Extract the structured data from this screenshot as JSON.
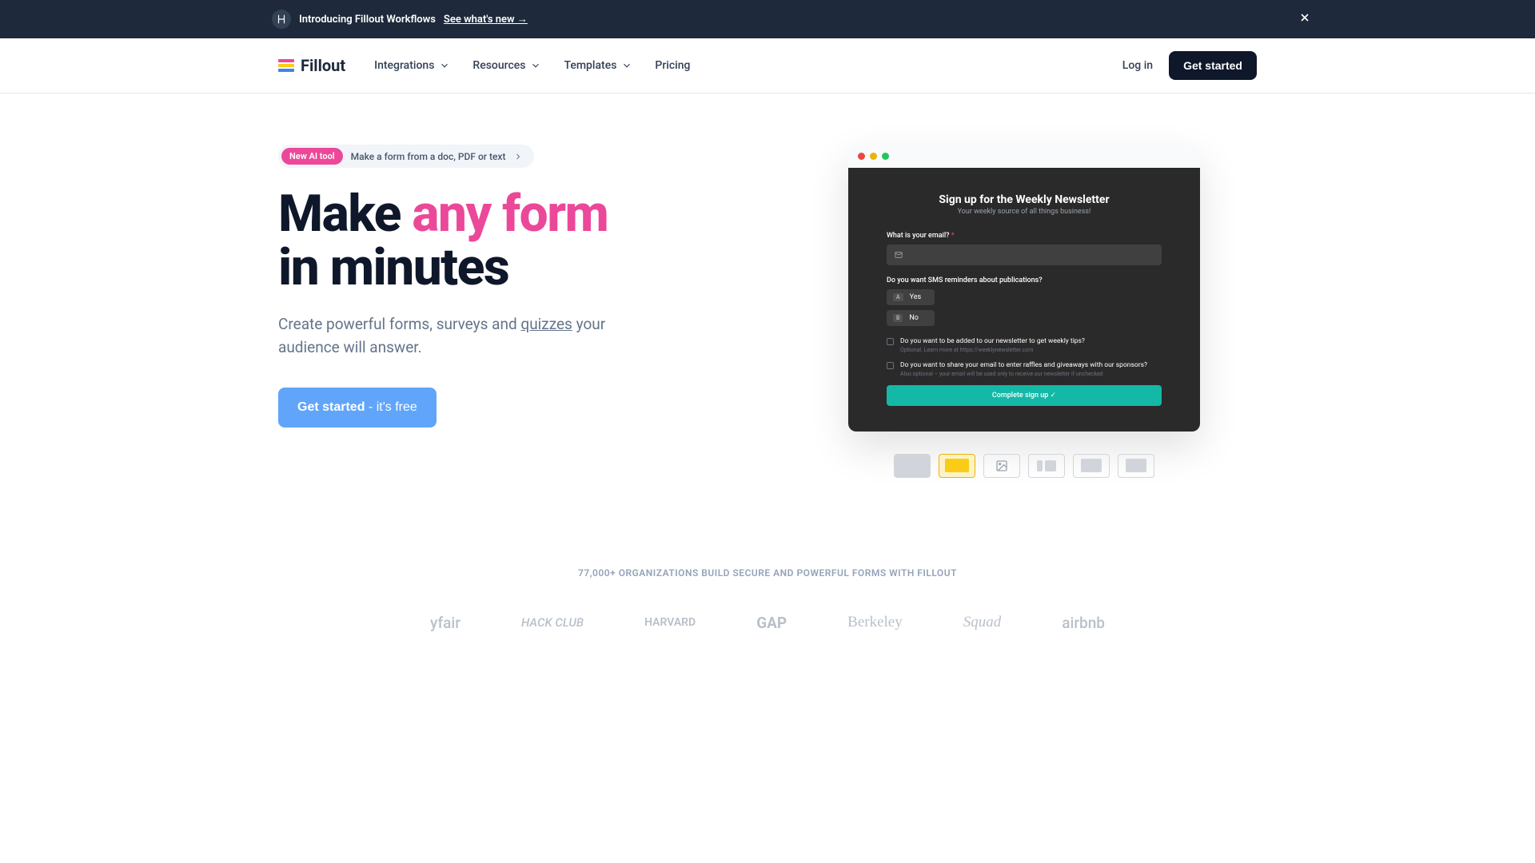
{
  "announcement": {
    "text": "Introducing Fillout Workflows",
    "link_text": "See what's new →"
  },
  "brand": "Fillout",
  "nav": {
    "integrations": "Integrations",
    "resources": "Resources",
    "templates": "Templates",
    "pricing": "Pricing"
  },
  "header_actions": {
    "login": "Log in",
    "get_started": "Get started"
  },
  "ai_pill": {
    "badge": "New AI tool",
    "text": "Make a form from a doc, PDF or text"
  },
  "hero": {
    "title_part1": "Make ",
    "title_highlight": "any form",
    "title_part2": " in minutes",
    "subtitle_pre": "Create powerful forms, surveys and ",
    "subtitle_underlined": "quizzes",
    "subtitle_post": " your audience will answer.",
    "cta_main": "Get started",
    "cta_suffix": " - it's free"
  },
  "preview_form": {
    "heading": "Sign up for the Weekly Newsletter",
    "subheading": "Your weekly source of all things business!",
    "email_label": "What is your email?",
    "sms_label": "Do you want SMS reminders about publications?",
    "opt_a_key": "A",
    "opt_a": "Yes",
    "opt_b_key": "B",
    "opt_b": "No",
    "check1_text": "Do you want to be added to our newsletter to get weekly tips?",
    "check1_hint": "Optional. Learn more at https://weeklynewsletter.com",
    "check2_text": "Do you want to share your email to enter raffles and giveaways with our sponsors?",
    "check2_hint": "Also optional – your email will be used only to receive our newsletter if unchecked",
    "submit": "Complete sign up ✓"
  },
  "social_proof": {
    "label": "77,000+ ORGANIZATIONS BUILD SECURE AND POWERFUL FORMS WITH FILLOUT",
    "logo1": "yfair",
    "logo2": "HACK CLUB",
    "logo3": "HARVARD",
    "logo4": "GAP",
    "logo5": "Berkeley",
    "logo6": "Squad",
    "logo7": "airbnb"
  }
}
